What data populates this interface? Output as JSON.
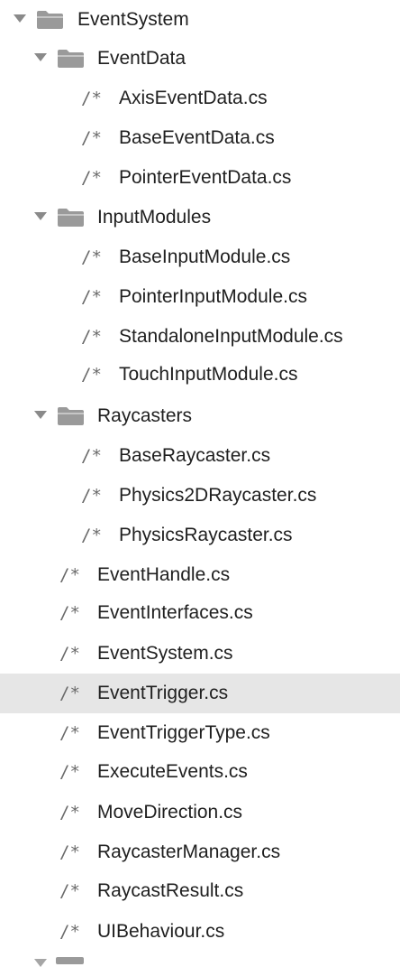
{
  "tree": {
    "root": {
      "label": "EventSystem",
      "icon": "folder-icon",
      "expanded": true
    },
    "folders": [
      {
        "label": "EventData",
        "icon": "folder-icon",
        "expanded": true,
        "files": [
          {
            "icon_text": "/*",
            "label": "AxisEventData.cs"
          },
          {
            "icon_text": "/*",
            "label": "BaseEventData.cs"
          },
          {
            "icon_text": "/*",
            "label": "PointerEventData.cs"
          }
        ]
      },
      {
        "label": "InputModules",
        "icon": "folder-icon",
        "expanded": true,
        "files": [
          {
            "icon_text": "/*",
            "label": "BaseInputModule.cs"
          },
          {
            "icon_text": "/*",
            "label": "PointerInputModule.cs"
          },
          {
            "icon_text": "/*",
            "label": "StandaloneInputModule.cs"
          },
          {
            "icon_text": "/*",
            "label": "TouchInputModule.cs"
          }
        ]
      },
      {
        "label": "Raycasters",
        "icon": "folder-icon",
        "expanded": true,
        "files": [
          {
            "icon_text": "/*",
            "label": "BaseRaycaster.cs"
          },
          {
            "icon_text": "/*",
            "label": "Physics2DRaycaster.cs"
          },
          {
            "icon_text": "/*",
            "label": "PhysicsRaycaster.cs"
          }
        ]
      }
    ],
    "files": [
      {
        "icon_text": "/*",
        "label": "EventHandle.cs"
      },
      {
        "icon_text": "/*",
        "label": "EventInterfaces.cs"
      },
      {
        "icon_text": "/*",
        "label": "EventSystem.cs"
      },
      {
        "icon_text": "/*",
        "label": "EventTrigger.cs",
        "selected": true
      },
      {
        "icon_text": "/*",
        "label": "EventTriggerType.cs"
      },
      {
        "icon_text": "/*",
        "label": "ExecuteEvents.cs"
      },
      {
        "icon_text": "/*",
        "label": "MoveDirection.cs"
      },
      {
        "icon_text": "/*",
        "label": "RaycasterManager.cs"
      },
      {
        "icon_text": "/*",
        "label": "RaycastResult.cs"
      },
      {
        "icon_text": "/*",
        "label": "UIBehaviour.cs"
      }
    ]
  },
  "colors": {
    "selection_background": "#e6e6e6",
    "folder_icon": "#9a9a9a",
    "disclosure_arrow": "#8a8a8a",
    "text": "#1f1f1f"
  }
}
